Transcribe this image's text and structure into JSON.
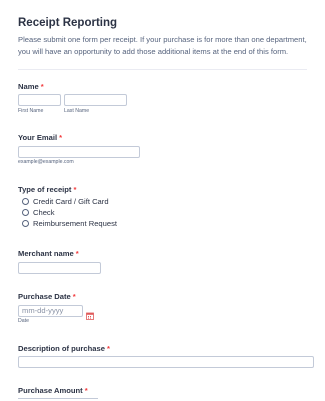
{
  "form": {
    "title": "Receipt Reporting",
    "description": "Please submit one form per receipt. If your purchase is for more than one department, you will have an opportunity to add those additional items at the end of this form."
  },
  "fields": {
    "name": {
      "label": "Name",
      "required": "*",
      "first_sub": "First Name",
      "last_sub": "Last Name"
    },
    "email": {
      "label": "Your Email",
      "required": "*",
      "sub": "example@example.com"
    },
    "receipt_type": {
      "label": "Type of receipt",
      "required": "*",
      "options": [
        "Credit Card / Gift Card",
        "Check",
        "Reimbursement Request"
      ]
    },
    "merchant": {
      "label": "Merchant name",
      "required": "*"
    },
    "purchase_date": {
      "label": "Purchase Date",
      "required": "*",
      "placeholder": "mm-dd-yyyy",
      "sub": "Date"
    },
    "description_of_purchase": {
      "label": "Description of purchase",
      "required": "*"
    },
    "purchase_amount": {
      "label": "Purchase Amount",
      "required": "*"
    }
  },
  "colors": {
    "required": "#f23a3c",
    "border": "#c3cad8",
    "calendar_icon": "#e05a5a"
  },
  "icons": {
    "date_picker": "calendar-icon"
  }
}
